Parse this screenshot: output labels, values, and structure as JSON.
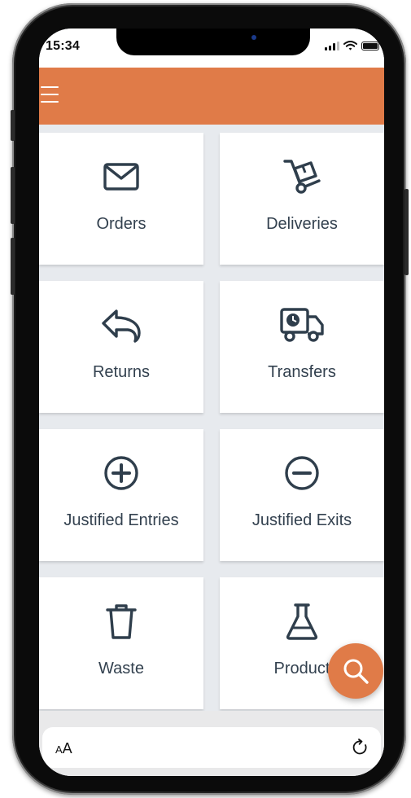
{
  "status_bar": {
    "time": "15:34"
  },
  "header": {
    "background": "#e07b48"
  },
  "tiles": [
    {
      "label": "Orders",
      "icon": "envelope-icon"
    },
    {
      "label": "Deliveries",
      "icon": "hand-truck-icon"
    },
    {
      "label": "Returns",
      "icon": "undo-arrow-icon"
    },
    {
      "label": "Transfers",
      "icon": "delivery-truck-clock-icon"
    },
    {
      "label": "Justified Entries",
      "icon": "plus-circle-icon"
    },
    {
      "label": "Justified Exits",
      "icon": "minus-circle-icon"
    },
    {
      "label": "Waste",
      "icon": "trash-icon"
    },
    {
      "label": "Product",
      "icon": "flask-icon"
    }
  ],
  "fab": {
    "icon": "search-icon"
  },
  "browser_bar": {
    "text_size_small": "A",
    "text_size_large": "A",
    "reload_icon": "reload-icon"
  },
  "colors": {
    "accent": "#e07b48",
    "icon": "#2f3e4c",
    "background": "#e7eaee"
  }
}
